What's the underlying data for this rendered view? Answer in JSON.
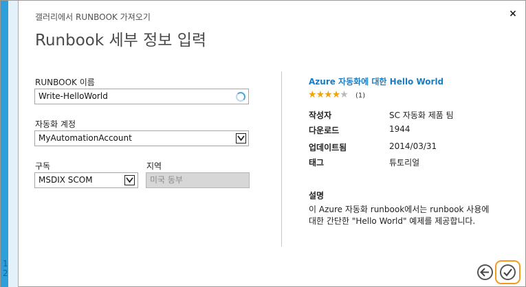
{
  "dialog": {
    "subtitle": "갤러리에서 RUNBOOK 가져오기",
    "title": "Runbook 세부 정보 입력",
    "close_glyph": "×"
  },
  "wizard": {
    "step_1": "1",
    "step_2": "2"
  },
  "form": {
    "runbook_name": {
      "label": "RUNBOOK 이름",
      "value": "Write-HelloWorld"
    },
    "automation_account": {
      "label": "자동화 계정",
      "value": "MyAutomationAccount"
    },
    "subscription": {
      "label": "구독",
      "value": "MSDIX SCOM"
    },
    "region": {
      "label": "지역",
      "value": "미국 동부"
    }
  },
  "runbook_info": {
    "title": "Azure 자동화에 대한 Hello World",
    "rating": 4,
    "rating_max": 5,
    "rating_count": "(1)",
    "meta": {
      "author_key": "작성자",
      "author_val": "SC 자동화 제품 팀",
      "downloads_key": "다운로드",
      "downloads_val": "1944",
      "updated_key": "업데이트됨",
      "updated_val": "2014/03/31",
      "tags_key": "태그",
      "tags_val": "튜토리얼"
    },
    "description_title": "설명",
    "description_line1": "이 Azure 자동화 runbook에서는 runbook 사용에",
    "description_line2": "대한 간단한 \"Hello World\" 예제를 제공합니다."
  },
  "colors": {
    "accent": "#199bd5",
    "link": "#1a7dc4",
    "star": "#f0a30a",
    "highlight": "#f29a1f"
  },
  "icons": {
    "close": "close-icon",
    "back": "arrow-left-icon",
    "confirm": "checkmark-icon",
    "dropdown": "chevron-down-icon"
  }
}
